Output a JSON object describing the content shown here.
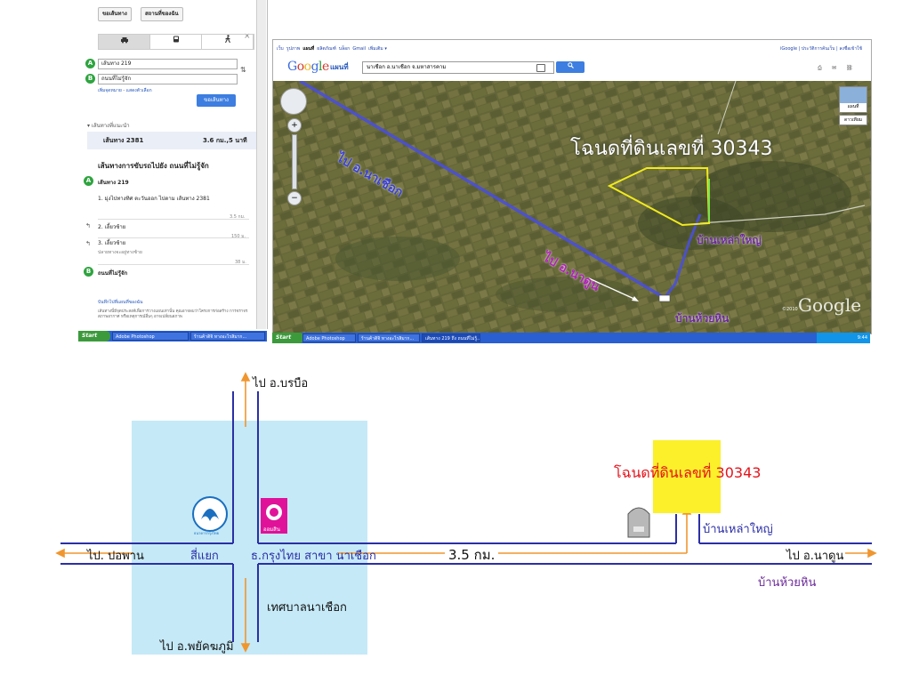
{
  "directions_panel": {
    "top_buttons": [
      "ขอเส้นทาง",
      "สถานที่ของฉัน"
    ],
    "mode_icons": [
      "car-icon",
      "transit-icon",
      "walk-icon"
    ],
    "close_glyph": "×",
    "waypoint_a": {
      "marker": "A",
      "value": "เส้นทาง 219"
    },
    "waypoint_b": {
      "marker": "B",
      "value": "ถนนที่ไม่รู้จัก"
    },
    "add_destination": "เพิ่มจุดหมาย - แสดงตัวเลือก",
    "get_directions": "ขอเส้นทาง",
    "suggested_routes": "เส้นทางที่แนะนำ",
    "route_summary": {
      "name": "เส้นทาง 2381",
      "distance_time": "3.6 กม.,5 นาที"
    },
    "driving_heading": "เส้นทางการขับรถไปยัง ถนนที่ไม่รู้จัก",
    "start": {
      "marker": "A",
      "label": "เส้นทาง 219"
    },
    "steps": [
      {
        "text": "1. มุ่งไปทางทิศ ตะวันออก ไปตาม เส้นทาง 2381",
        "distance": "3.5 กม."
      },
      {
        "text": "2. เลี้ยวซ้าย",
        "distance": "150 ม."
      },
      {
        "text": "3. เลี้ยวซ้าย",
        "sub": "ปลายทางจะอยู่ทางซ้าย",
        "distance": "38 ม."
      }
    ],
    "end": {
      "marker": "B",
      "label": "ถนนที่ไม่รู้จัก"
    },
    "save_link": "บันทึกไปที่แผนที่ของฉัน",
    "disclaimer": "เส้นทางนี้มีจุดประสงค์เพื่อการวางแผนเท่านั้น คุณอาจพบว่าโครงการก่อสร้าง การจราจร สภาพอากาศ หรือเหตุการณ์อื่นๆ อาจเปลี่ยนสภาพ"
  },
  "google_map": {
    "top_nav": [
      "เว็บ",
      "รูปภาพ",
      "แผนที่",
      "ผลิตภัณฑ์",
      "บล็อก",
      "Gmail",
      "เพิ่มเติม ▾"
    ],
    "top_right": "iGoogle | ประวัติการค้นเว็บ | ลงชื่อเข้าใช้",
    "logo": "Google",
    "subtitle": "แผนที่",
    "search_value": "นาเชือก อ.นาเชือก จ.มหาสารคาม",
    "search_icon": "search-icon",
    "view_buttons": [
      "แผนที่",
      "ดาวเทียม"
    ],
    "watermark": "Google",
    "copyright": "©2010",
    "labels": {
      "plot": "โฉนดที่ดินเลขที่ 30343",
      "to_nachueak": "ไป อ.นาเชือก",
      "to_nadun": "ไป อ.นาดูน",
      "ban_lao_yai": "บ้านเหล่าใหญ่",
      "ban_huai_hin": "บ้านห้วยหิน"
    }
  },
  "taskbar_left": {
    "start": "Start",
    "items": [
      "Adobe Photoshop",
      "ร้านค้าดิจิ ทางอะไรสิมาก..."
    ]
  },
  "taskbar_right": {
    "start": "Start",
    "items": [
      "Adobe Photoshop",
      "ร้านค้าดิจิ ทางอะไรสิมาก...",
      "เส้นทาง 219 ถึง ถนนที่ไม่รู้..."
    ],
    "tray_time": "9:44"
  },
  "sketch_map": {
    "to_borabue": "ไป อ.บรบือ",
    "to_phayakkhaphum": "ไป อ.พยัคฆภูมิ",
    "to_po_phan": "ไป. ปอพาน",
    "to_nadun": "ไป อ.นาดูน",
    "intersection": "สี่แยก",
    "bank_branch": "ธ.กรุงไทย สาขา นาเชือก",
    "distance": "3.5 กม.",
    "municipality": "เทศบาลนาเชือก",
    "plot": "โฉนดที่ดินเลขที่ 30343",
    "ban_lao_yai": "บ้านเหล่าใหญ่",
    "ban_huai_hin": "บ้านห้วยหิน",
    "krungthai_logo_text": "ธนาคารกรุงไทย",
    "gsb_logo_text": "ออมสิน",
    "colors": {
      "road": "#2b2fa6",
      "arrow": "#f0962e",
      "town_zone": "#c5e9f7",
      "plot_highlight": "#fbf02a",
      "plot_text": "#e5131b",
      "village_text": "#6c2a9a",
      "krungthai": "#1a6fc0",
      "gsb": "#e0129a"
    }
  }
}
